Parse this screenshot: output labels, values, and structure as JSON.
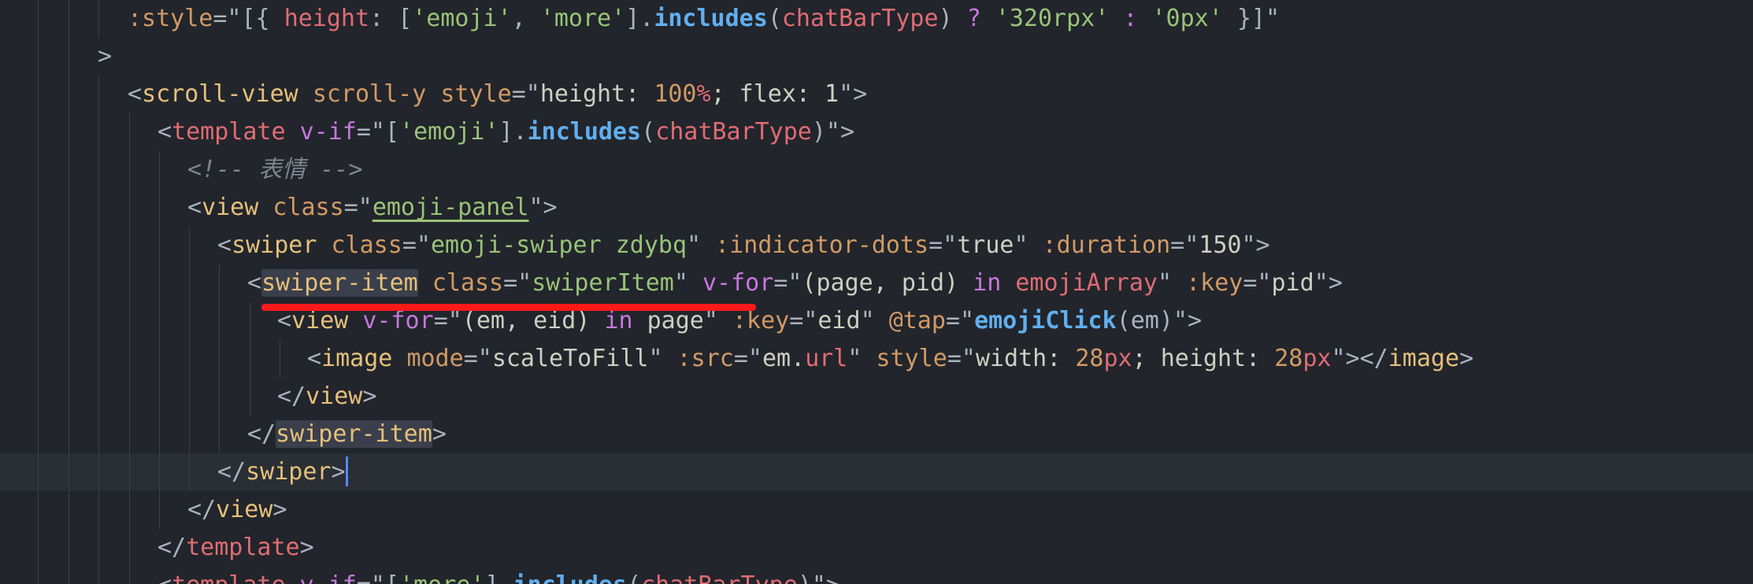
{
  "editor": {
    "lines": [
      ":style=\"[{ height: ['emoji', 'more'].includes(chatBarType) ? '320rpx' : '0px' }]\"",
      ">",
      "<scroll-view scroll-y style=\"height: 100%; flex: 1\">",
      "<template v-if=\"['emoji'].includes(chatBarType)\">",
      "<!-- 表情 -->",
      "<view class=\"emoji-panel\">",
      "<swiper class=\"emoji-swiper zdybq\" :indicator-dots=\"true\" :duration=\"150\">",
      "<swiper-item class=\"swiperItem\" v-for=\"(page, pid) in emojiArray\" :key=\"pid\">",
      "<view v-for=\"(em, eid) in page\" :key=\"eid\" @tap=\"emojiClick(em)\">",
      "<image mode=\"scaleToFill\" :src=\"em.url\" style=\"width: 28px; height: 28px\"></image>",
      "</view>",
      "</swiper-item>",
      "</swiper>",
      "</view>",
      "</template>",
      "<template v-if=\"['more'].includes(chatBarType)\">"
    ]
  },
  "colors": {
    "background": "#22252b",
    "current_line": "#2a2e35",
    "annotation_underline": "#ff1a1a",
    "cursor": "#528bff"
  }
}
